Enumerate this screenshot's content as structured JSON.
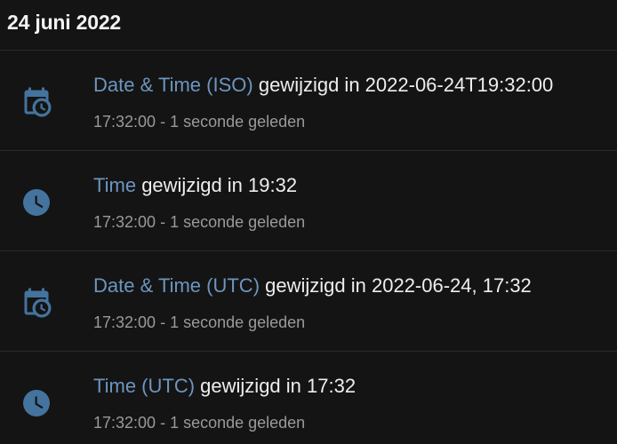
{
  "logbook": {
    "date_header": "24 juni 2022",
    "entries": [
      {
        "icon": "calendar-clock-icon",
        "entity": "Date & Time (ISO)",
        "message": " gewijzigd in 2022-06-24T19:32:00",
        "time": "17:32:00",
        "relative": "1 seconde geleden",
        "meta": "17:32:00 - 1 seconde geleden"
      },
      {
        "icon": "clock-icon",
        "entity": "Time",
        "message": " gewijzigd in 19:32",
        "time": "17:32:00",
        "relative": "1 seconde geleden",
        "meta": "17:32:00 - 1 seconde geleden"
      },
      {
        "icon": "calendar-clock-icon",
        "entity": "Date & Time (UTC)",
        "message": " gewijzigd in 2022-06-24, 17:32",
        "time": "17:32:00",
        "relative": "1 seconde geleden",
        "meta": "17:32:00 - 1 seconde geleden"
      },
      {
        "icon": "clock-icon",
        "entity": "Time (UTC)",
        "message": " gewijzigd in 17:32",
        "time": "17:32:00",
        "relative": "1 seconde geleden",
        "meta": "17:32:00 - 1 seconde geleden"
      }
    ]
  },
  "colors": {
    "background": "#141414",
    "icon_blue": "#44739e",
    "entity_link": "#6c95bf",
    "primary_text": "#eeeeee",
    "secondary_text": "#9a9a9a"
  }
}
